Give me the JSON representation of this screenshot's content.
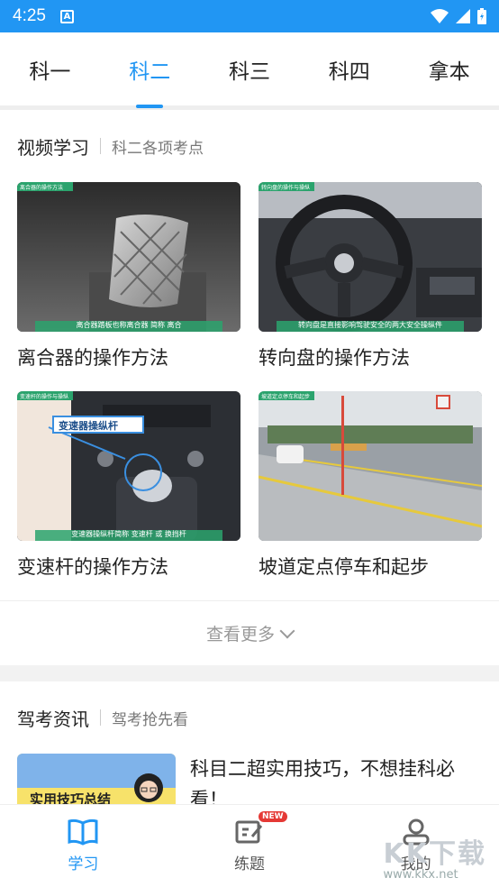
{
  "status": {
    "time": "4:25",
    "notif_letter": "A"
  },
  "tabs": [
    {
      "label": "科一"
    },
    {
      "label": "科二"
    },
    {
      "label": "科三"
    },
    {
      "label": "科四"
    },
    {
      "label": "拿本"
    }
  ],
  "video_section": {
    "title": "视频学习",
    "subtitle": "科二各项考点"
  },
  "videos": [
    {
      "title": "离合器的操作方法",
      "tag": "离合器的操作方法",
      "caption": "离合器踏板也称离合器 简称 离合"
    },
    {
      "title": "转向盘的操作方法",
      "tag": "转向盘的操作与操纵",
      "caption": "转向盘是直接影响驾驶安全的两大安全操纵件"
    },
    {
      "title": "变速杆的操作方法",
      "tag": "变速杆的操作与操纵",
      "caption": "变速器操纵杆简称 变速杆 或 换挡杆",
      "overlay_label": "变速器操纵杆"
    },
    {
      "title": "坡道定点停车和起步",
      "tag": "坡道定点停车和起步",
      "caption": ""
    }
  ],
  "more": {
    "label": "查看更多"
  },
  "news_section": {
    "title": "驾考资讯",
    "subtitle": "驾考抢先看"
  },
  "news": [
    {
      "title": "科目二超实用技巧，不想挂科必看！",
      "thumb_text": "实用技巧总结"
    }
  ],
  "bottom_nav": [
    {
      "label": "学习",
      "icon": "book-icon"
    },
    {
      "label": "练题",
      "icon": "edit-icon",
      "badge": "NEW"
    },
    {
      "label": "我的",
      "icon": "person-icon"
    }
  ],
  "watermark": {
    "big": "KK下载",
    "url": "www.kkx.net"
  },
  "colors": {
    "accent": "#2196f3",
    "badge": "#e53935"
  }
}
